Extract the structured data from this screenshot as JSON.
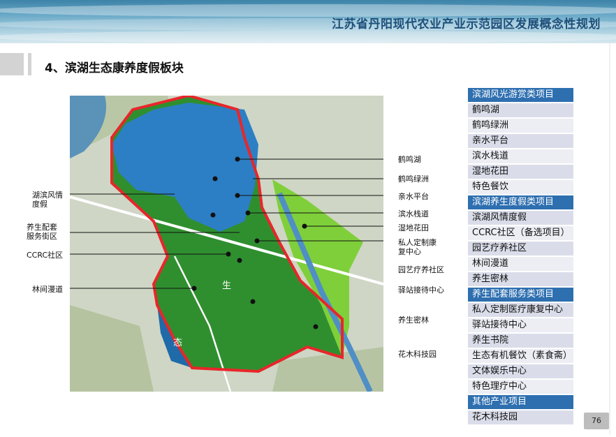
{
  "header": {
    "title": "江苏省丹阳现代农业产业示范园区发展概念性规划"
  },
  "section": {
    "title": "4、滨湖生态康养度假板块"
  },
  "map": {
    "right_labels": [
      "鹤鸣湖",
      "鹤鸣绿洲",
      "亲水平台",
      "滨水栈道",
      "湿地花田",
      "私人定制康\n复中心",
      "园艺疗养社区",
      "驿站接待中心",
      "养生密林",
      "花木科技园"
    ],
    "left_labels": [
      "湖滨风情\n度假",
      "养生配套\n服务街区",
      "CCRC社区",
      "林间漫道"
    ],
    "overlay_chars": [
      "生",
      "态"
    ]
  },
  "legend_list": [
    {
      "text": "滨湖风光游赏类项目",
      "header": true
    },
    {
      "text": "鹤鸣湖"
    },
    {
      "text": "鹤鸣绿洲"
    },
    {
      "text": "亲水平台"
    },
    {
      "text": "滨水栈道"
    },
    {
      "text": "湿地花田"
    },
    {
      "text": "特色餐饮"
    },
    {
      "text": "滨湖养生度假类项目",
      "header": true
    },
    {
      "text": "滨湖风情度假"
    },
    {
      "text": "CCRC社区（备选项目）"
    },
    {
      "text": "园艺疗养社区"
    },
    {
      "text": "林间漫道"
    },
    {
      "text": "养生密林"
    },
    {
      "text": "养生配套服务类项目",
      "header": true
    },
    {
      "text": "私人定制医疗康复中心"
    },
    {
      "text": "驿站接待中心"
    },
    {
      "text": "养生书院"
    },
    {
      "text": "生态有机餐饮（素食斋）"
    },
    {
      "text": "文体娱乐中心"
    },
    {
      "text": "特色理疗中心"
    },
    {
      "text": "其他产业项目",
      "header": true
    },
    {
      "text": "花木科技园"
    }
  ],
  "page_number": "76",
  "colors": {
    "header_row": "#2e6fb0",
    "row": "#dadde9",
    "row_alt": "#eceef4",
    "boundary": "#e8262a",
    "lake": "#2c7fc4"
  }
}
